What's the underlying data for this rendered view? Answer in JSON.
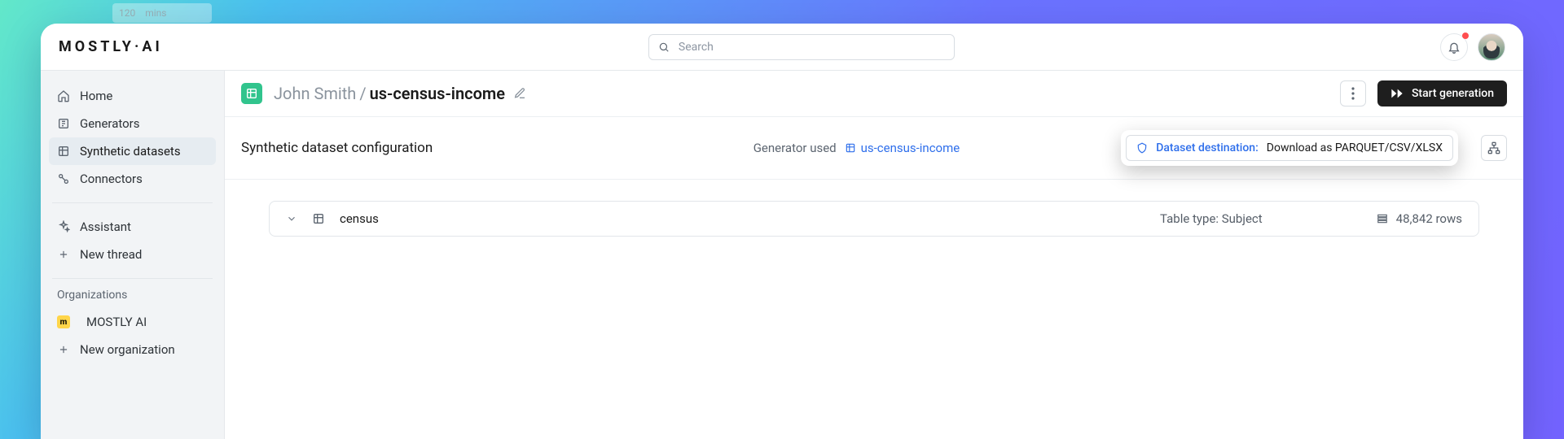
{
  "ghost": {
    "left": "120",
    "right": "mins"
  },
  "logo": {
    "text": "MOSTLY·AI"
  },
  "search": {
    "placeholder": "Search"
  },
  "sidebar": {
    "items": [
      {
        "label": "Home"
      },
      {
        "label": "Generators"
      },
      {
        "label": "Synthetic datasets"
      },
      {
        "label": "Connectors"
      }
    ],
    "assistant": {
      "label": "Assistant"
    },
    "new_thread": {
      "label": "New thread"
    },
    "orgs_header": "Organizations",
    "org": {
      "badge": "m",
      "label": "MOSTLY AI"
    },
    "new_org": {
      "label": "New organization"
    }
  },
  "page": {
    "owner": "John Smith",
    "sep": "/",
    "name": "us-census-income",
    "start": "Start generation"
  },
  "config": {
    "title": "Synthetic dataset configuration",
    "gen_label": "Generator used",
    "gen_name": "us-census-income",
    "dest_label": "Dataset destination:",
    "dest_value": "Download as PARQUET/CSV/XLSX"
  },
  "table": {
    "name": "census",
    "type_label": "Table type: Subject",
    "rows": "48,842 rows"
  }
}
